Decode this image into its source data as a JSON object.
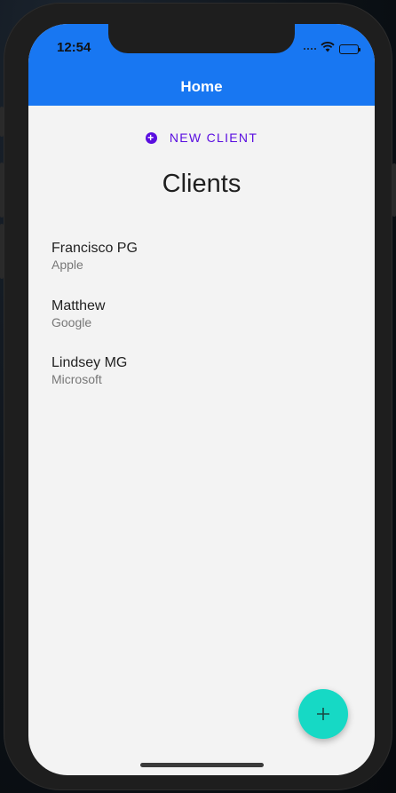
{
  "status_bar": {
    "time": "12:54",
    "icons": [
      "signal-icon",
      "wifi-icon",
      "battery-icon"
    ]
  },
  "header": {
    "title": "Home",
    "color": "#1877f2"
  },
  "actions": {
    "new_client_label": "NEW CLIENT",
    "new_client_icon": "plus-circle-icon",
    "accent_color": "#5a0ee0"
  },
  "main": {
    "title": "Clients",
    "clients": [
      {
        "name": "Francisco PG",
        "company": "Apple"
      },
      {
        "name": "Matthew",
        "company": "Google"
      },
      {
        "name": "Lindsey MG",
        "company": "Microsoft"
      }
    ]
  },
  "fab": {
    "icon": "plus-icon",
    "color": "#16d9c5"
  }
}
